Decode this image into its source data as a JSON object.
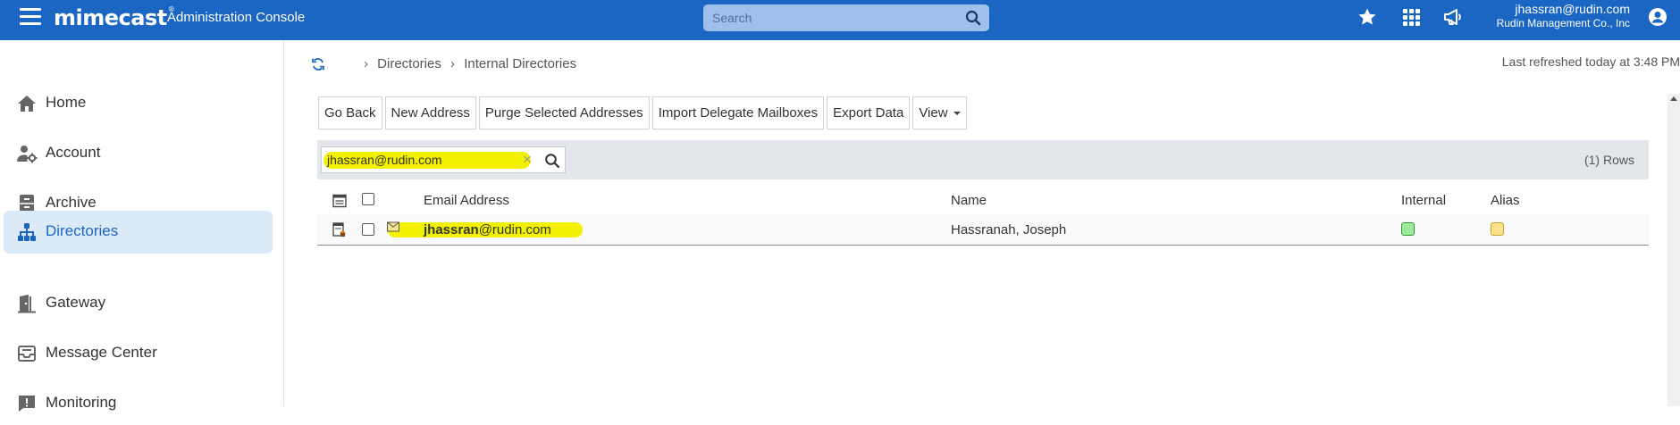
{
  "header": {
    "brand": "mimecast",
    "brand_mark": "®",
    "console_title": "Administration Console",
    "search_placeholder": "Search",
    "user_email": "jhassran@rudin.com",
    "user_org": "Rudin Management Co., Inc",
    "icons": [
      "menu-icon",
      "search-icon",
      "star-icon",
      "apps-grid-icon",
      "megaphone-icon",
      "user-account-icon"
    ]
  },
  "sidebar": {
    "items": [
      {
        "label": "Home",
        "icon": "home-icon"
      },
      {
        "label": "Account",
        "icon": "account-gear-icon"
      },
      {
        "label": "Archive",
        "icon": "archive-cabinet-icon"
      },
      {
        "label": "Directories",
        "icon": "directories-hierarchy-icon",
        "active": true
      },
      {
        "label": "Gateway",
        "icon": "gateway-door-icon"
      },
      {
        "label": "Message Center",
        "icon": "message-center-icon"
      },
      {
        "label": "Monitoring",
        "icon": "monitoring-alert-icon"
      }
    ]
  },
  "breadcrumb": {
    "items": [
      "Directories",
      "Internal Directories"
    ]
  },
  "last_refreshed": "Last refreshed today at 3:48 PM",
  "toolbar": {
    "buttons": [
      "Go Back",
      "New Address",
      "Purge Selected Addresses",
      "Import Delegate Mailboxes",
      "Export Data",
      "View"
    ]
  },
  "filter": {
    "value": "jhassran@rudin.com",
    "rows_count": "(1) Rows"
  },
  "table": {
    "columns": [
      "Email Address",
      "Name",
      "Internal",
      "Alias"
    ],
    "rows": [
      {
        "email_user": "jhassran",
        "email_domain": "@rudin.com",
        "name": "Hassranah, Joseph",
        "internal_color": "#9de89a",
        "alias_color": "#ffe08a"
      }
    ]
  },
  "colors": {
    "header_bg": "#1a66c2",
    "active_nav_bg": "#dceaf7",
    "highlight": "#f2f200"
  }
}
